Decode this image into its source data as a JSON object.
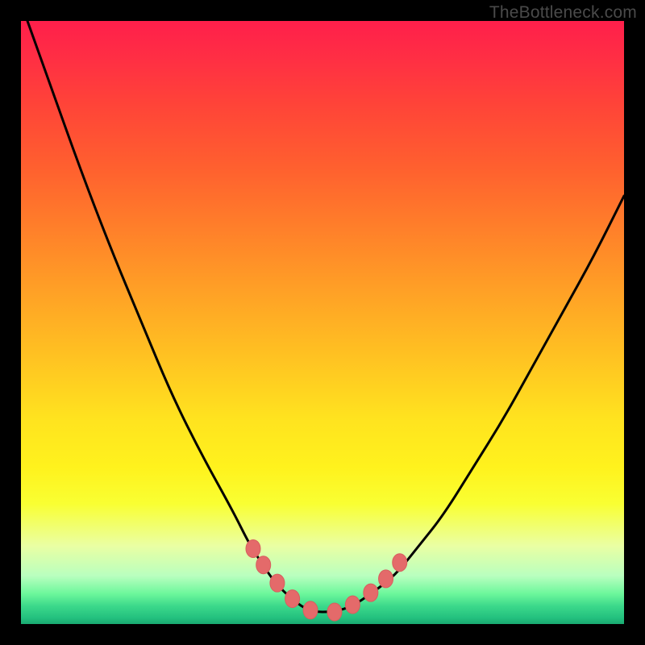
{
  "watermark": "TheBottleneck.com",
  "chart_data": {
    "type": "line",
    "title": "",
    "xlabel": "",
    "ylabel": "",
    "xlim": [
      0,
      100
    ],
    "ylim": [
      0,
      100
    ],
    "curve": {
      "name": "value",
      "x": [
        0,
        5,
        10,
        15,
        20,
        25,
        30,
        35,
        38,
        40,
        42,
        45,
        48,
        52,
        55,
        58,
        62,
        66,
        70,
        75,
        80,
        85,
        90,
        95,
        100
      ],
      "y": [
        103,
        89,
        75,
        62,
        50,
        38,
        28,
        19,
        13,
        10,
        7,
        4,
        2,
        2,
        3,
        5,
        8,
        13,
        18,
        26,
        34,
        43,
        52,
        61,
        71
      ]
    },
    "markers": {
      "name": "highlight-points",
      "x": [
        38.5,
        40.2,
        42.5,
        45,
        48,
        52,
        55,
        58,
        60.5,
        62.8
      ],
      "y": [
        12.5,
        9.8,
        6.8,
        4.2,
        2.3,
        2.0,
        3.2,
        5.2,
        7.5,
        10.2
      ]
    },
    "colors": {
      "curve": "#000000",
      "marker_fill": "#e46a6a",
      "marker_stroke": "#d85e5e"
    }
  }
}
